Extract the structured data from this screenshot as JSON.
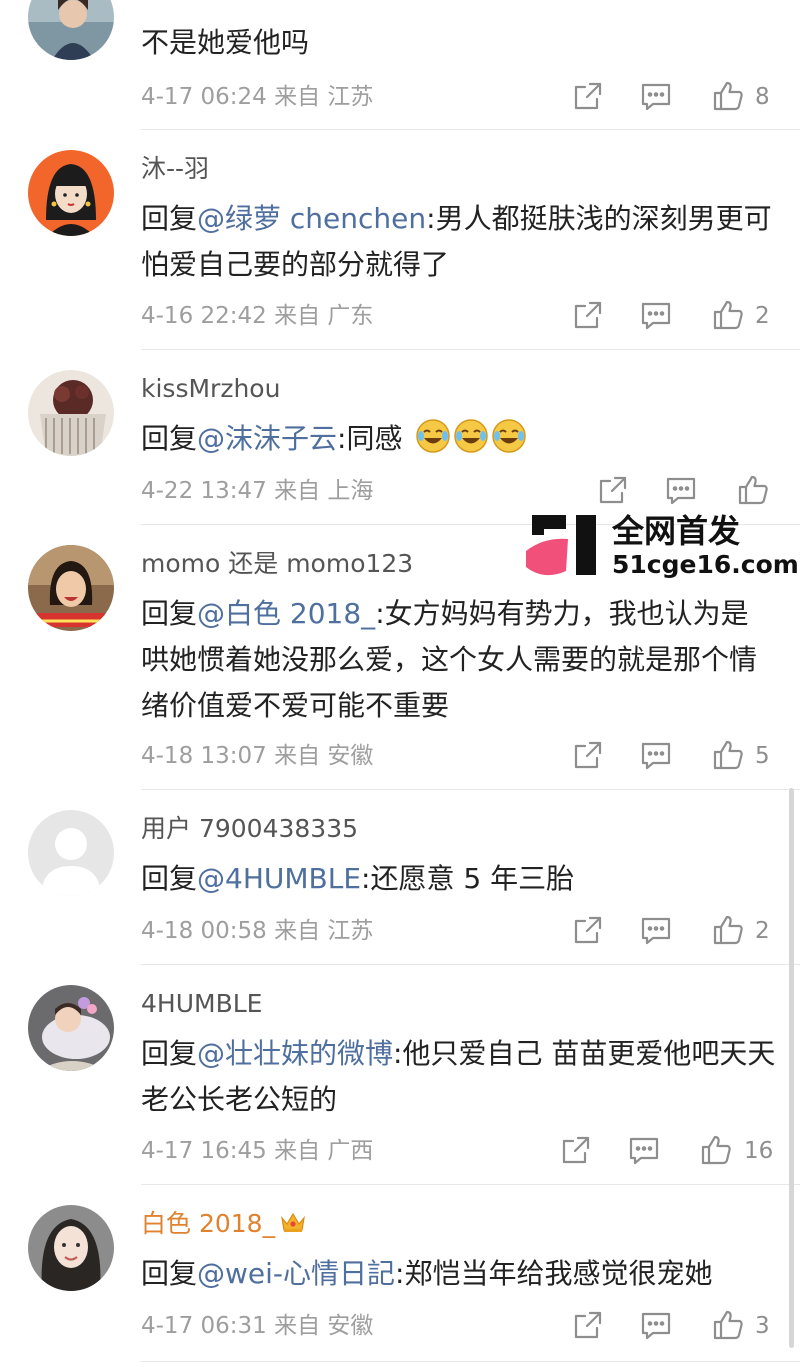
{
  "colors": {
    "mention": "#4f6f9f",
    "vip_name": "#e0822e",
    "text": "#222222",
    "meta": "#9e9e9e",
    "watermark_pink": "#f0507a"
  },
  "watermark": {
    "title": "全网首发",
    "site": "51cge16.com"
  },
  "comments": [
    {
      "username": "",
      "body": "不是她爱他吗",
      "meta": "4-17 06:24 来自 江苏",
      "likes": "8"
    },
    {
      "username": "沐--羽",
      "reply_prefix": "回复",
      "mention": "@绿萝 chenchen",
      "text": ":男人都挺肤浅的深刻男更可怕爱自己要的部分就得了",
      "meta": "4-16 22:42 来自 广东",
      "likes": "2"
    },
    {
      "username": "kissMrzhou",
      "reply_prefix": "回复",
      "mention": "@沫沫子云",
      "text": ":同感",
      "emoji_count": 3,
      "meta": "4-22 13:47 来自 上海",
      "likes": ""
    },
    {
      "username": "momo 还是 momo123",
      "reply_prefix": "回复",
      "mention": "@白色 2018_",
      "text": ":女方妈妈有势力，我也认为是哄她惯着她没那么爱，这个女人需要的就是那个情绪价值爱不爱可能不重要",
      "meta": "4-18 13:07 来自 安徽",
      "likes": "5"
    },
    {
      "username": "用户 7900438335",
      "reply_prefix": "回复",
      "mention": "@4HUMBLE",
      "text": ":还愿意 5 年三胎",
      "meta": "4-18 00:58 来自 江苏",
      "likes": "2"
    },
    {
      "username": "4HUMBLE",
      "reply_prefix": "回复",
      "mention": "@壮壮妹的微博",
      "text": ":他只爱自己 苗苗更爱他吧天天老公长老公短的",
      "meta": "4-17 16:45 来自 广西",
      "likes": "16"
    },
    {
      "username": "白色 2018_",
      "reply_prefix": "回复",
      "mention": "@wei-心情日記",
      "text": ":郑恺当年给我感觉很宠她",
      "meta": "4-17 06:31 来自 安徽",
      "likes": "3"
    }
  ]
}
